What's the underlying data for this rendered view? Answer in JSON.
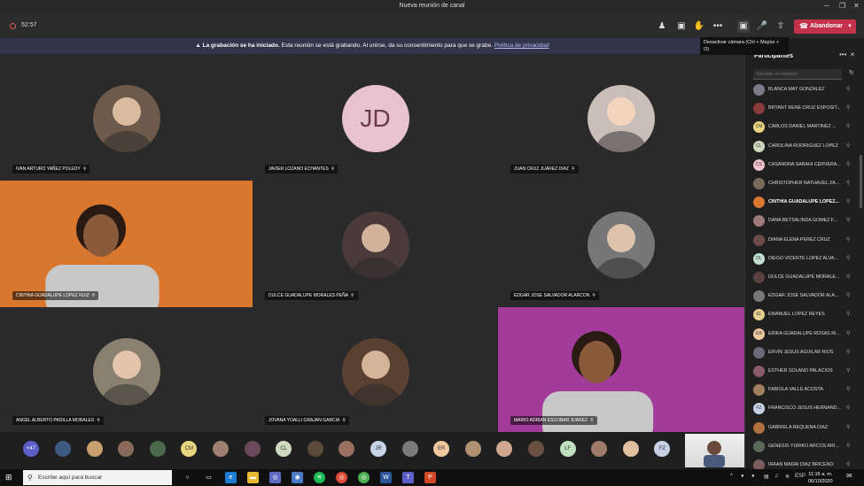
{
  "window": {
    "title": "Nueva reunión de canal"
  },
  "toolbar": {
    "timer": "52:57",
    "leave_label": "Abandonar",
    "camera_tooltip": "Desactivar cámara (Ctrl + Mayús + O)"
  },
  "banner": {
    "bold": "La grabación se ha iniciado.",
    "text": "Esta reunión se está grabando. Al unirse, da su consentimiento para que se grabe.",
    "link": "Política de privacidad"
  },
  "tiles": [
    {
      "name": "IVAN ARTURO YAÑEZ POLEDY",
      "type": "photo",
      "color": "#6d5a4a"
    },
    {
      "name": "JAVIER LOZANO ECHANTES",
      "type": "initials",
      "initials": "JD"
    },
    {
      "name": "JUAN CRUZ JUAREZ DIAZ",
      "type": "photo",
      "color": "#c9bfb8"
    },
    {
      "name": "CINTHIA GUADALUPE LOPEZ RUIZ",
      "type": "video",
      "color": "#d9772f"
    },
    {
      "name": "DULCE GUADALUPE MORALES PEÑA",
      "type": "photo",
      "color": "#4a3a3a"
    },
    {
      "name": "EDGAR JOSE SALVADOR ALARCON",
      "type": "photo",
      "color": "#777"
    },
    {
      "name": "ANGEL ALBERTO PADILLA MORALES",
      "type": "photo",
      "color": "#8a8070"
    },
    {
      "name": "JOVANA YOALLI GRAJAN GARCIA",
      "type": "photo",
      "color": "#5a4030"
    },
    {
      "name": "MARIO ADRIAN ESCOBAR JUAREZ",
      "type": "video",
      "color": "#a23b9a"
    }
  ],
  "strip": {
    "overflow": "+47",
    "avatars": [
      {
        "label": "",
        "color": "#3d5a80"
      },
      {
        "label": "",
        "color": "#c8a070"
      },
      {
        "label": "",
        "color": "#8a6a5a"
      },
      {
        "label": "",
        "color": "#4a6a4a"
      },
      {
        "label": "CM",
        "color": "#e8d580"
      },
      {
        "label": "",
        "color": "#a08070"
      },
      {
        "label": "",
        "color": "#6a4a5a"
      },
      {
        "label": "CL",
        "color": "#cfd9c0"
      },
      {
        "label": "",
        "color": "#5a4a3a"
      },
      {
        "label": "",
        "color": "#9a7060"
      },
      {
        "label": "JR",
        "color": "#c8d4e8"
      },
      {
        "label": "",
        "color": "#7a7a7a"
      },
      {
        "label": "ER",
        "color": "#f0c8a0"
      },
      {
        "label": "",
        "color": "#b09070"
      },
      {
        "label": "",
        "color": "#d0a890"
      },
      {
        "label": "",
        "color": "#6a5040"
      },
      {
        "label": "LF",
        "color": "#c0e0c0"
      },
      {
        "label": "",
        "color": "#a07a6a"
      },
      {
        "label": "",
        "color": "#e0c0a0"
      },
      {
        "label": "FZ",
        "color": "#c8d0e8"
      }
    ]
  },
  "panel": {
    "title": "Participantes",
    "search_placeholder": "Escribe un nombre",
    "participants": [
      {
        "name": "BLANCA MAY GONZALEZ",
        "initials": "",
        "color": "#7a7a8a"
      },
      {
        "name": "BRYANT RENE CRUZ ESPOSIT...",
        "initials": "",
        "color": "#8a3a3a"
      },
      {
        "name": "CARLOS DANIEL MARTINEZ ...",
        "initials": "CM",
        "color": "#e8d580"
      },
      {
        "name": "CAROLINA RODRIGUEZ LOPEZ",
        "initials": "CL",
        "color": "#cfd9c0"
      },
      {
        "name": "CASANDRA SARAHI CERVERA...",
        "initials": "CS",
        "color": "#f0c0c8"
      },
      {
        "name": "CHRISTOPHER NATHAUEL ZA...",
        "initials": "",
        "color": "#7a6a5a"
      },
      {
        "name": "CINTHIA GUADALUPE LOPEZ...",
        "initials": "",
        "color": "#d9772f"
      },
      {
        "name": "DANA BETSALINDA GOMEZ F...",
        "initials": "",
        "color": "#9a7a7a"
      },
      {
        "name": "DIANA ELENA PEREZ CRUZ",
        "initials": "",
        "color": "#6a4a4a"
      },
      {
        "name": "DIEGO VICENTE LOPEZ ALVAR...",
        "initials": "DL",
        "color": "#c0e0d0"
      },
      {
        "name": "DULCE GUADALUPE MORALE...",
        "initials": "",
        "color": "#5a4040"
      },
      {
        "name": "EDGAR JOSE SALVADOR ALA...",
        "initials": "",
        "color": "#777"
      },
      {
        "name": "EMANUEL LOPEZ REYES",
        "initials": "EL",
        "color": "#e8d090"
      },
      {
        "name": "ERIKA GUADALUPE ROSAS RI...",
        "initials": "ER",
        "color": "#f0c8a0"
      },
      {
        "name": "ERVIN JESUS AGUILAR RIOS",
        "initials": "",
        "color": "#6a6a7a"
      },
      {
        "name": "ESTHER SOLANO PALACIOS",
        "initials": "",
        "color": "#8a5a6a"
      },
      {
        "name": "FABIOLA VALLE ACOSTA",
        "initials": "",
        "color": "#a08060"
      },
      {
        "name": "FRANCISCO JESUS HERNAND...",
        "initials": "FZ",
        "color": "#c8d0e8"
      },
      {
        "name": "GABRIELA REQUENA DIAZ",
        "initials": "",
        "color": "#b07040"
      },
      {
        "name": "GENESIS YURIKO ARCOS ARIAS",
        "initials": "",
        "color": "#5a6a5a"
      },
      {
        "name": "IRAAN MADAI DIAZ BRICENO",
        "initials": "",
        "color": "#7a5a5a"
      }
    ]
  },
  "taskbar": {
    "search_placeholder": "Escribe aquí para buscar",
    "lang": "ESP",
    "time": "11:16 a. m.",
    "date": "06/10/2020"
  }
}
